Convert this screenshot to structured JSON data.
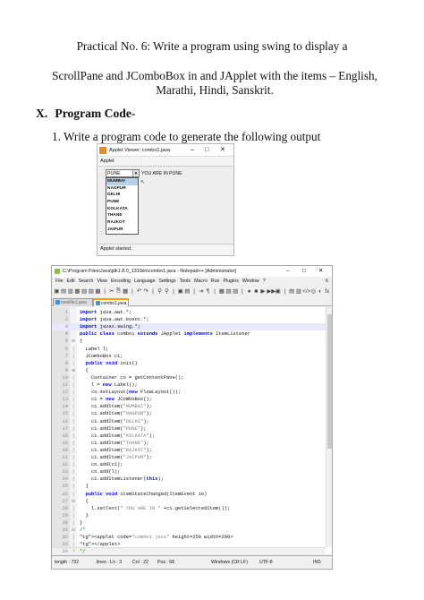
{
  "heading": {
    "line1": "Practical No. 6: Write a program using swing to display a",
    "line2": "ScrollPane and JComboBox in and JApplet with the items – English, Marathi, Hindi, Sanskrit."
  },
  "section": {
    "number": "X.",
    "title": "Program Code-"
  },
  "step": "1.  Write a program code to generate the following output",
  "applet": {
    "title": "Applet Viewer: combo1.java",
    "window_controls": [
      "–",
      "□",
      "✕"
    ],
    "menu": "Applet",
    "combo_value": "PUNE",
    "combo_arrow": "▼",
    "selected_text": "YOU ARE IN PUNE",
    "items": [
      "MUMBAI",
      "NAGPUR",
      "DELHI",
      "PUNE",
      "KOLKATA",
      "THANE",
      "RAJKOT",
      "JAIPUR"
    ],
    "highlighted": "MUMBAI",
    "cursor": "↖",
    "status": "Applet started."
  },
  "notepad": {
    "title": "C:\\Program Files\\Java\\jdk1.8.0_131\\bin\\combo1.java - Notepad++ [Administrator]",
    "window_controls": [
      "–",
      "□",
      "✕"
    ],
    "menu": [
      "File",
      "Edit",
      "Search",
      "View",
      "Encoding",
      "Language",
      "Settings",
      "Tools",
      "Macro",
      "Run",
      "Plugins",
      "Window",
      "?"
    ],
    "menu_close": "X",
    "toolbar_glyphs": [
      "▣",
      "▤",
      "▥",
      "▦",
      "▧",
      "▨",
      "▩",
      "|",
      "✂",
      "⎘",
      "▦",
      "|",
      "↶",
      "↷",
      "|",
      "⚲",
      "⚲",
      "|",
      "▣",
      "▤",
      "|",
      "⇥",
      "¶",
      "|",
      "▦",
      "▧",
      "▨",
      "|",
      "●",
      "■",
      "▶",
      "▶▶",
      "▣",
      "|",
      "▤",
      "▥",
      "</>",
      "◎",
      "◐",
      "fx"
    ],
    "tabs": [
      "newfile1.java",
      "combo1.java"
    ],
    "lines": [
      "import java.awt.*;",
      "import java.awt.event.*;",
      "import javax.swing.*;",
      "public class combo1 extends JApplet implements ItemListener",
      "{",
      "  Label l;",
      "  JComboBox c1;",
      "  public void init()",
      "  {",
      "    Container co = getContentPane();",
      "    l = new Label();",
      "    co.setLayout(new FlowLayout());",
      "    c1 = new JComboBox();",
      "    c1.addItem(\"MUMBAI\");",
      "    c1.addItem(\"NAGPUR\");",
      "    c1.addItem(\"DELHI\");",
      "    c1.addItem(\"PUNE\");",
      "    c1.addItem(\"KOLKATA\");",
      "    c1.addItem(\"THANE\");",
      "    c1.addItem(\"RAJKOT\");",
      "    c1.addItem(\"JAIPUR\");",
      "    co.add(c1);",
      "    co.add(l);",
      "    c1.addItemListener(this);",
      "  }",
      "  public void itemStateChanged(ItemEvent ie)",
      "  {",
      "    l.setText(\" YOU ARE IN \" +c1.getSelectedItem());",
      "  }",
      "}",
      "/*",
      "<applet code=\"combo1.java\" height=250 width=200>",
      "</applet>",
      "*/"
    ],
    "status": {
      "length": "length : 732",
      "lines": "lines : Ln : 3",
      "col": "Col : 22",
      "pos": "Pos : 68",
      "eol": "Windows (CR LF)",
      "enc": "UTF-8",
      "mode": "INS"
    }
  }
}
